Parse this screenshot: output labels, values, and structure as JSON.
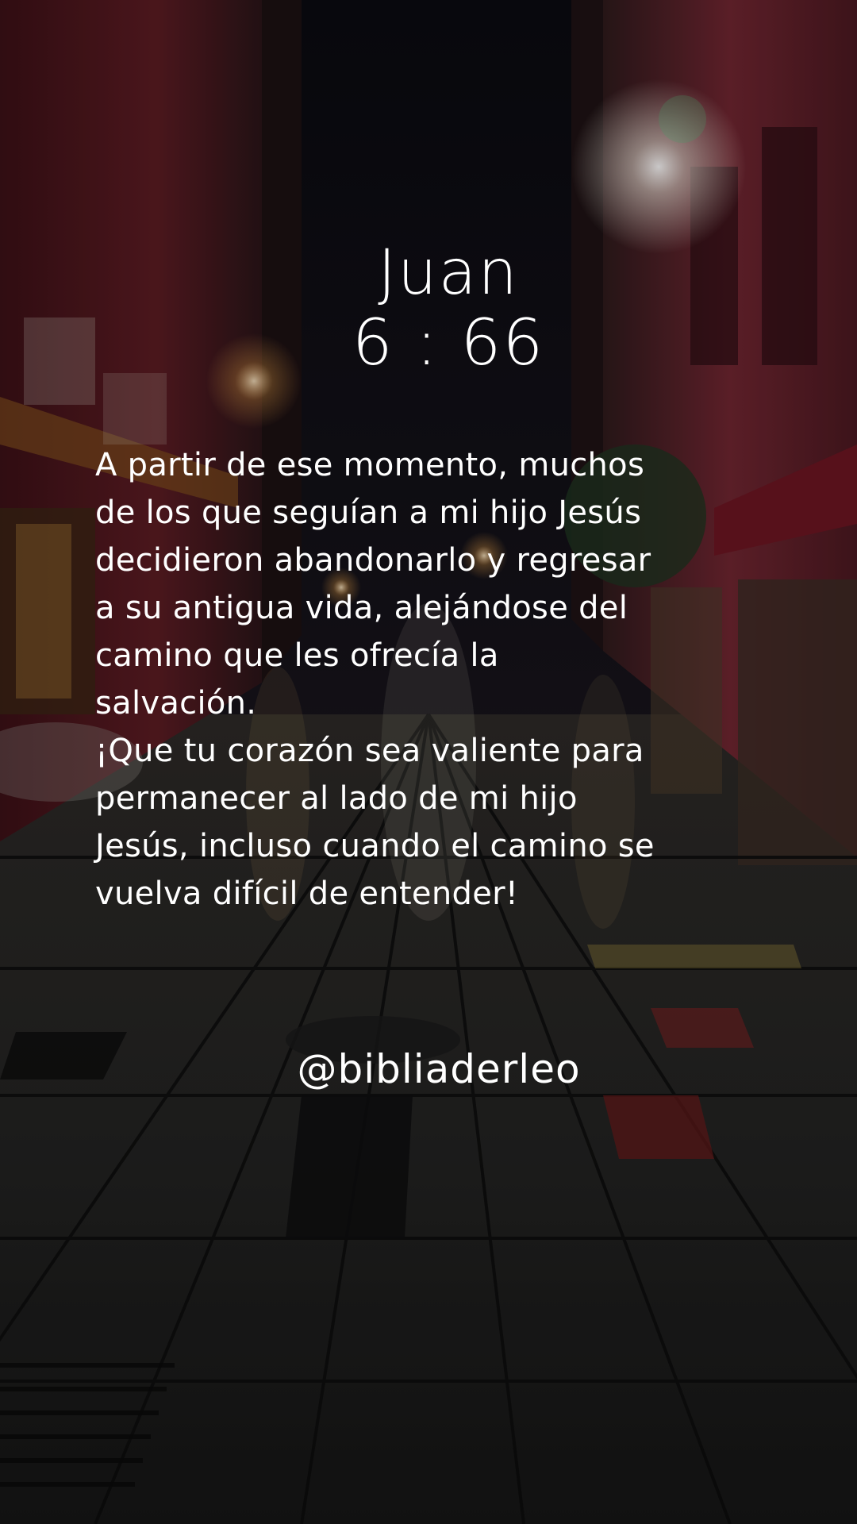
{
  "verse": {
    "book": "Juan",
    "chapter_verse": "6 : 66",
    "paragraphs": [
      "A partir de ese momento, muchos de los que seguían a mi hijo Jesús decidieron abandonarlo y regresar a su antigua vida, alejándose del camino que les ofrecía la salvación.",
      "¡Que tu corazón sea valiente para permanecer al lado de mi hijo Jesús, incluso cuando el camino se vuelva difícil de entender!"
    ]
  },
  "handle": "@bibliaderleo",
  "colors": {
    "text": "#ffffff",
    "sky": "#0c0b10",
    "wall_left": "#5a1b22",
    "wall_right": "#6e2530",
    "pavement": "#2a2a2c",
    "light": "#f2efe6"
  }
}
